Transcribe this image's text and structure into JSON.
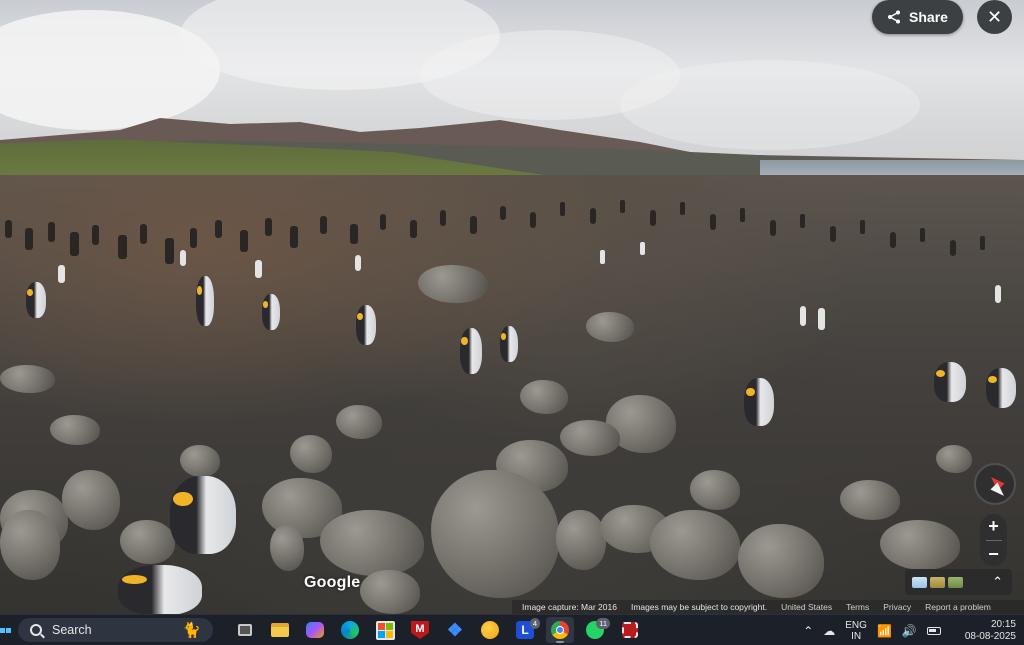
{
  "overlay": {
    "share_label": "Share",
    "share_icon": "share-icon",
    "close_icon": "close-icon"
  },
  "branding": {
    "logo_text": "Google"
  },
  "footer": {
    "image_capture": "Image capture: Mar 2016",
    "copyright": "Images may be subject to copyright.",
    "country": "United States",
    "terms": "Terms",
    "privacy": "Privacy",
    "report": "Report a problem"
  },
  "controls": {
    "zoom_in": "+",
    "zoom_out": "−",
    "expand_icon": "chevron-up-icon",
    "compass_icon": "compass-icon"
  },
  "taskbar": {
    "search_placeholder": "Search",
    "apps": [
      {
        "name": "task-view"
      },
      {
        "name": "file-explorer"
      },
      {
        "name": "copilot"
      },
      {
        "name": "edge"
      },
      {
        "name": "microsoft-store"
      },
      {
        "name": "mcafee"
      },
      {
        "name": "dropbox"
      },
      {
        "name": "weather"
      },
      {
        "name": "app-l",
        "badge": "4"
      },
      {
        "name": "chrome",
        "active": true
      },
      {
        "name": "whatsapp",
        "badge": "11"
      },
      {
        "name": "snipping-tool"
      }
    ],
    "tray": {
      "lang_top": "ENG",
      "lang_bottom": "IN",
      "time": "20:15",
      "date": "08-08-2025"
    }
  },
  "colors": {
    "control_bg": "#3c4043",
    "taskbar_bg": "#1c2129",
    "compass_red": "#e53935"
  }
}
